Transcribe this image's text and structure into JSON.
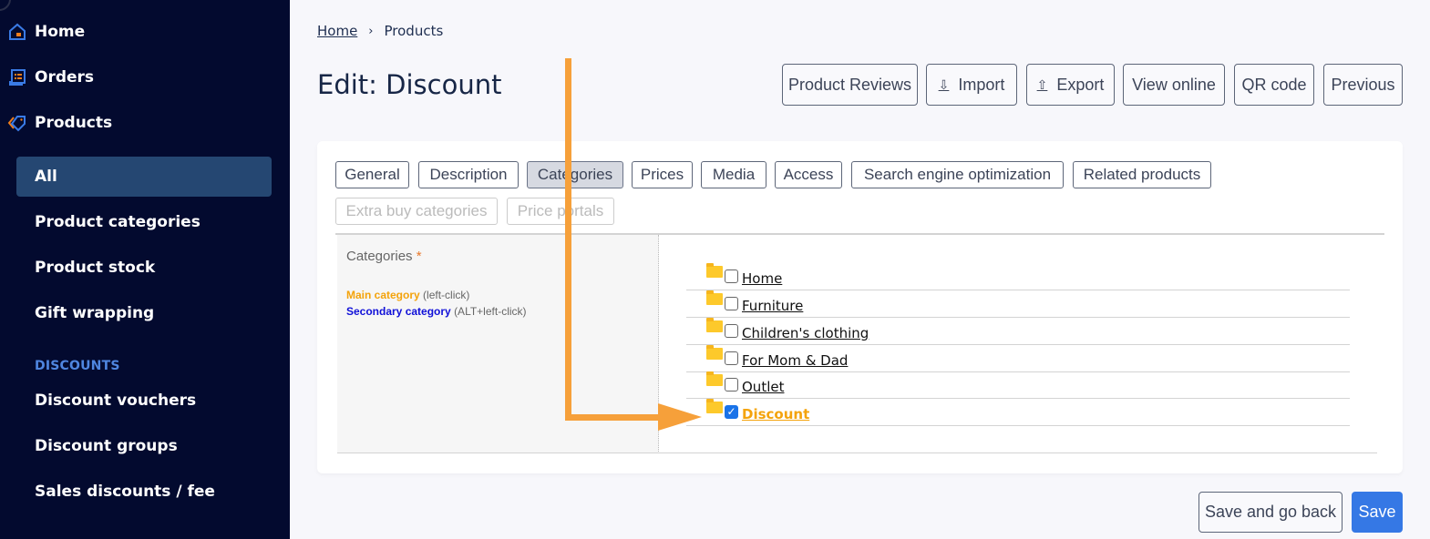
{
  "sidebar": {
    "main_items": [
      {
        "label": "Home",
        "icon": "home-icon"
      },
      {
        "label": "Orders",
        "icon": "orders-icon"
      },
      {
        "label": "Products",
        "icon": "tag-icon"
      }
    ],
    "sub_items": [
      {
        "label": "All",
        "active": true
      },
      {
        "label": "Product categories"
      },
      {
        "label": "Product stock"
      },
      {
        "label": "Gift wrapping"
      }
    ],
    "discounts_title": "DISCOUNTS",
    "discount_items": [
      {
        "label": "Discount vouchers"
      },
      {
        "label": "Discount groups"
      },
      {
        "label": "Sales discounts / fee"
      }
    ]
  },
  "breadcrumb": {
    "home": "Home",
    "separator": "›",
    "current": "Products"
  },
  "page_title": "Edit: Discount",
  "header_buttons": [
    {
      "label": "Product Reviews"
    },
    {
      "label": "Import",
      "icon": "download-icon",
      "glyph": "⇩"
    },
    {
      "label": "Export",
      "icon": "upload-icon",
      "glyph": "⇧"
    },
    {
      "label": "View online"
    },
    {
      "label": "QR code"
    },
    {
      "label": "Previous"
    }
  ],
  "tabs": [
    {
      "label": "General"
    },
    {
      "label": "Description"
    },
    {
      "label": "Categories",
      "active": true
    },
    {
      "label": "Prices"
    },
    {
      "label": "Media"
    },
    {
      "label": "Access"
    },
    {
      "label": "Search engine optimization"
    },
    {
      "label": "Related products"
    },
    {
      "label": "Extra buy categories",
      "disabled": true
    },
    {
      "label": "Price portals",
      "disabled": true
    }
  ],
  "categories_panel": {
    "label": "Categories",
    "required_mark": "*",
    "legend_main": "Main category",
    "legend_main_hint": "(left-click)",
    "legend_secondary": "Secondary category",
    "legend_secondary_hint": "(ALT+left-click)",
    "items": [
      {
        "name": "Home",
        "checked": false
      },
      {
        "name": "Furniture",
        "checked": false
      },
      {
        "name": "Children's clothing",
        "checked": false
      },
      {
        "name": "For Mom & Dad",
        "checked": false
      },
      {
        "name": "Outlet",
        "checked": false
      },
      {
        "name": "Discount",
        "checked": true,
        "main": true
      }
    ]
  },
  "footer": {
    "save_and_back": "Save and go back",
    "save": "Save"
  },
  "colors": {
    "sidebar_bg": "#030a2f",
    "active_item": "#254772",
    "accent_orange": "#f6a03a",
    "save_blue": "#3578e5",
    "main_category": "#f4a30b",
    "secondary_category": "#1010d8"
  }
}
